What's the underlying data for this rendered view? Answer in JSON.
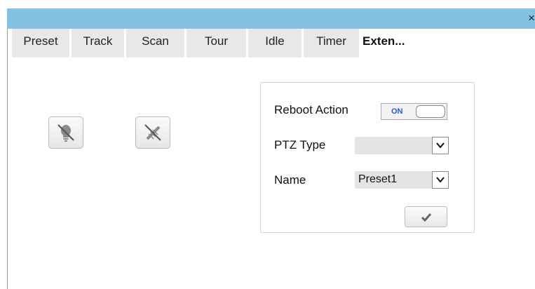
{
  "window": {
    "close_label": "×"
  },
  "tabs": [
    {
      "label": "Preset"
    },
    {
      "label": "Track"
    },
    {
      "label": "Scan"
    },
    {
      "label": "Tour"
    },
    {
      "label": "Idle"
    },
    {
      "label": "Timer"
    },
    {
      "label": "Exten..."
    }
  ],
  "controls": {
    "light_icon": "light-bulb-icon",
    "wiper_icon": "wiper-icon"
  },
  "panel": {
    "reboot_action_label": "Reboot Action",
    "reboot_toggle_text": "ON",
    "ptz_type_label": "PTZ Type",
    "ptz_type_value": "",
    "name_label": "Name",
    "name_value": "Preset1",
    "confirm_icon": "checkmark-icon"
  },
  "colors": {
    "titlebar": "#85c1e3",
    "toggle_on_text": "#1a5fd1"
  }
}
